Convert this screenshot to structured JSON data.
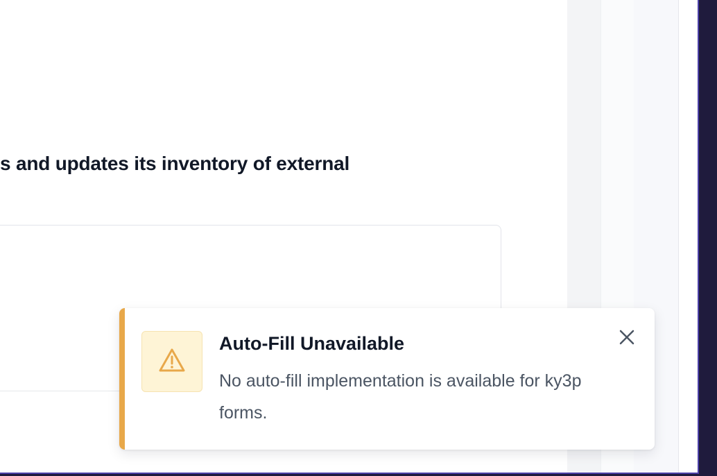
{
  "main": {
    "heading_fragment": "s and updates its inventory of external"
  },
  "toast": {
    "title": "Auto-Fill Unavailable",
    "message": "No auto-fill implementation is available for ky3p forms.",
    "icon": "warning-triangle-icon",
    "close_icon": "close-icon",
    "accent_color": "#e8a84a",
    "icon_bg_color": "#fef4d6"
  }
}
